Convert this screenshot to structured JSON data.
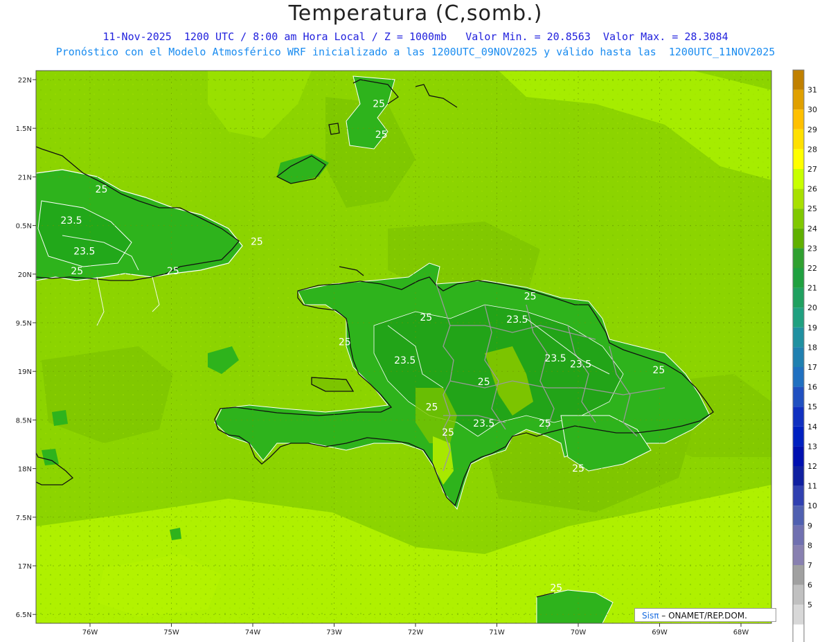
{
  "title": "Temperatura (C,somb.)",
  "subtitle_line1": "11-Nov-2025  1200 UTC / 8:00 am Hora Local / Z = 1000mb   Valor Min. = 20.8563  Valor Max. = 28.3084",
  "subtitle_line2": "Pronóstico con el Modelo Atmosférico WRF inicializado a las 1200UTC_09NOV2025 y válido hasta las  1200UTC_11NOV2025",
  "credit": {
    "brand": "Sisπ",
    "text": " – ONAMET/REP.DOM."
  },
  "lat_labels": [
    "22N",
    "1.5N",
    "21N",
    "0.5N",
    "20N",
    "9.5N",
    "19N",
    "8.5N",
    "18N",
    "7.5N",
    "17N",
    "6.5N"
  ],
  "lon_labels": [
    "76W",
    "75W",
    "74W",
    "73W",
    "72W",
    "71W",
    "70W",
    "69W",
    "68W"
  ],
  "colorbar": {
    "labels": [
      "31",
      "30",
      "29",
      "28",
      "27",
      "26",
      "25",
      "24",
      "23",
      "22",
      "21",
      "20",
      "19",
      "18",
      "17",
      "16",
      "15",
      "14",
      "13",
      "12",
      "11",
      "10",
      "9",
      "8",
      "7",
      "6",
      "5"
    ],
    "colors": [
      "#c08000",
      "#e0a000",
      "#ffc000",
      "#ffe000",
      "#ffff00",
      "#c8ff00",
      "#a8e000",
      "#80c800",
      "#60b000",
      "#30a030",
      "#20a040",
      "#20a060",
      "#20a080",
      "#2090a0",
      "#2080b0",
      "#2070c0",
      "#2050c0",
      "#1030c0",
      "#0020c0",
      "#0010b0",
      "#1020a0",
      "#3040b0",
      "#5060b0",
      "#7070b0",
      "#8880b0",
      "#a0a0a0",
      "#c0c0c0",
      "#d8d8d8",
      "#ffffff"
    ]
  },
  "contour_labels": [
    {
      "text": "25",
      "lon": -72.45,
      "lat": 21.72
    },
    {
      "text": "25",
      "lon": -72.42,
      "lat": 21.4
    },
    {
      "text": "25",
      "lon": -75.86,
      "lat": 20.84
    },
    {
      "text": "25",
      "lon": -73.95,
      "lat": 20.3
    },
    {
      "text": "23.5",
      "lon": -76.23,
      "lat": 20.52
    },
    {
      "text": "23.5",
      "lon": -76.07,
      "lat": 20.2
    },
    {
      "text": "25",
      "lon": -76.16,
      "lat": 20.0
    },
    {
      "text": "25",
      "lon": -74.98,
      "lat": 20.0
    },
    {
      "text": "25",
      "lon": -70.59,
      "lat": 19.74
    },
    {
      "text": "25",
      "lon": -71.87,
      "lat": 19.52
    },
    {
      "text": "23.5",
      "lon": -70.75,
      "lat": 19.5
    },
    {
      "text": "25",
      "lon": -72.87,
      "lat": 19.27
    },
    {
      "text": "23.5",
      "lon": -72.13,
      "lat": 19.08
    },
    {
      "text": "23.5",
      "lon": -70.28,
      "lat": 19.1
    },
    {
      "text": "23.5",
      "lon": -69.97,
      "lat": 19.04
    },
    {
      "text": "25",
      "lon": -69.01,
      "lat": 18.98
    },
    {
      "text": "25",
      "lon": -71.16,
      "lat": 18.86
    },
    {
      "text": "25",
      "lon": -71.8,
      "lat": 18.6
    },
    {
      "text": "23.5",
      "lon": -71.16,
      "lat": 18.43
    },
    {
      "text": "25",
      "lon": -70.41,
      "lat": 18.43
    },
    {
      "text": "25",
      "lon": -71.6,
      "lat": 18.34
    },
    {
      "text": "25",
      "lon": -70.0,
      "lat": 17.97
    },
    {
      "text": "25",
      "lon": -70.27,
      "lat": 16.74
    }
  ]
}
